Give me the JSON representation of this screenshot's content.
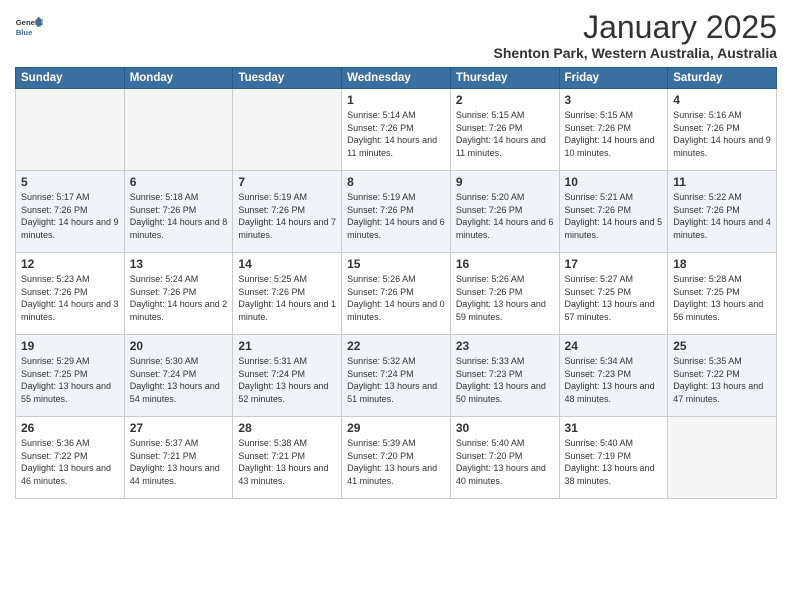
{
  "header": {
    "logo_line1": "General",
    "logo_line2": "Blue",
    "month": "January 2025",
    "location": "Shenton Park, Western Australia, Australia"
  },
  "days_of_week": [
    "Sunday",
    "Monday",
    "Tuesday",
    "Wednesday",
    "Thursday",
    "Friday",
    "Saturday"
  ],
  "weeks": [
    [
      {
        "day": "",
        "empty": true
      },
      {
        "day": "",
        "empty": true
      },
      {
        "day": "",
        "empty": true
      },
      {
        "day": "1",
        "sunrise": "5:14 AM",
        "sunset": "7:26 PM",
        "daylight": "14 hours and 11 minutes."
      },
      {
        "day": "2",
        "sunrise": "5:15 AM",
        "sunset": "7:26 PM",
        "daylight": "14 hours and 11 minutes."
      },
      {
        "day": "3",
        "sunrise": "5:15 AM",
        "sunset": "7:26 PM",
        "daylight": "14 hours and 10 minutes."
      },
      {
        "day": "4",
        "sunrise": "5:16 AM",
        "sunset": "7:26 PM",
        "daylight": "14 hours and 9 minutes."
      }
    ],
    [
      {
        "day": "5",
        "sunrise": "5:17 AM",
        "sunset": "7:26 PM",
        "daylight": "14 hours and 9 minutes."
      },
      {
        "day": "6",
        "sunrise": "5:18 AM",
        "sunset": "7:26 PM",
        "daylight": "14 hours and 8 minutes."
      },
      {
        "day": "7",
        "sunrise": "5:19 AM",
        "sunset": "7:26 PM",
        "daylight": "14 hours and 7 minutes."
      },
      {
        "day": "8",
        "sunrise": "5:19 AM",
        "sunset": "7:26 PM",
        "daylight": "14 hours and 6 minutes."
      },
      {
        "day": "9",
        "sunrise": "5:20 AM",
        "sunset": "7:26 PM",
        "daylight": "14 hours and 6 minutes."
      },
      {
        "day": "10",
        "sunrise": "5:21 AM",
        "sunset": "7:26 PM",
        "daylight": "14 hours and 5 minutes."
      },
      {
        "day": "11",
        "sunrise": "5:22 AM",
        "sunset": "7:26 PM",
        "daylight": "14 hours and 4 minutes."
      }
    ],
    [
      {
        "day": "12",
        "sunrise": "5:23 AM",
        "sunset": "7:26 PM",
        "daylight": "14 hours and 3 minutes."
      },
      {
        "day": "13",
        "sunrise": "5:24 AM",
        "sunset": "7:26 PM",
        "daylight": "14 hours and 2 minutes."
      },
      {
        "day": "14",
        "sunrise": "5:25 AM",
        "sunset": "7:26 PM",
        "daylight": "14 hours and 1 minute."
      },
      {
        "day": "15",
        "sunrise": "5:26 AM",
        "sunset": "7:26 PM",
        "daylight": "14 hours and 0 minutes."
      },
      {
        "day": "16",
        "sunrise": "5:26 AM",
        "sunset": "7:26 PM",
        "daylight": "13 hours and 59 minutes."
      },
      {
        "day": "17",
        "sunrise": "5:27 AM",
        "sunset": "7:25 PM",
        "daylight": "13 hours and 57 minutes."
      },
      {
        "day": "18",
        "sunrise": "5:28 AM",
        "sunset": "7:25 PM",
        "daylight": "13 hours and 56 minutes."
      }
    ],
    [
      {
        "day": "19",
        "sunrise": "5:29 AM",
        "sunset": "7:25 PM",
        "daylight": "13 hours and 55 minutes."
      },
      {
        "day": "20",
        "sunrise": "5:30 AM",
        "sunset": "7:24 PM",
        "daylight": "13 hours and 54 minutes."
      },
      {
        "day": "21",
        "sunrise": "5:31 AM",
        "sunset": "7:24 PM",
        "daylight": "13 hours and 52 minutes."
      },
      {
        "day": "22",
        "sunrise": "5:32 AM",
        "sunset": "7:24 PM",
        "daylight": "13 hours and 51 minutes."
      },
      {
        "day": "23",
        "sunrise": "5:33 AM",
        "sunset": "7:23 PM",
        "daylight": "13 hours and 50 minutes."
      },
      {
        "day": "24",
        "sunrise": "5:34 AM",
        "sunset": "7:23 PM",
        "daylight": "13 hours and 48 minutes."
      },
      {
        "day": "25",
        "sunrise": "5:35 AM",
        "sunset": "7:22 PM",
        "daylight": "13 hours and 47 minutes."
      }
    ],
    [
      {
        "day": "26",
        "sunrise": "5:36 AM",
        "sunset": "7:22 PM",
        "daylight": "13 hours and 46 minutes."
      },
      {
        "day": "27",
        "sunrise": "5:37 AM",
        "sunset": "7:21 PM",
        "daylight": "13 hours and 44 minutes."
      },
      {
        "day": "28",
        "sunrise": "5:38 AM",
        "sunset": "7:21 PM",
        "daylight": "13 hours and 43 minutes."
      },
      {
        "day": "29",
        "sunrise": "5:39 AM",
        "sunset": "7:20 PM",
        "daylight": "13 hours and 41 minutes."
      },
      {
        "day": "30",
        "sunrise": "5:40 AM",
        "sunset": "7:20 PM",
        "daylight": "13 hours and 40 minutes."
      },
      {
        "day": "31",
        "sunrise": "5:40 AM",
        "sunset": "7:19 PM",
        "daylight": "13 hours and 38 minutes."
      },
      {
        "day": "",
        "empty": true
      }
    ]
  ]
}
